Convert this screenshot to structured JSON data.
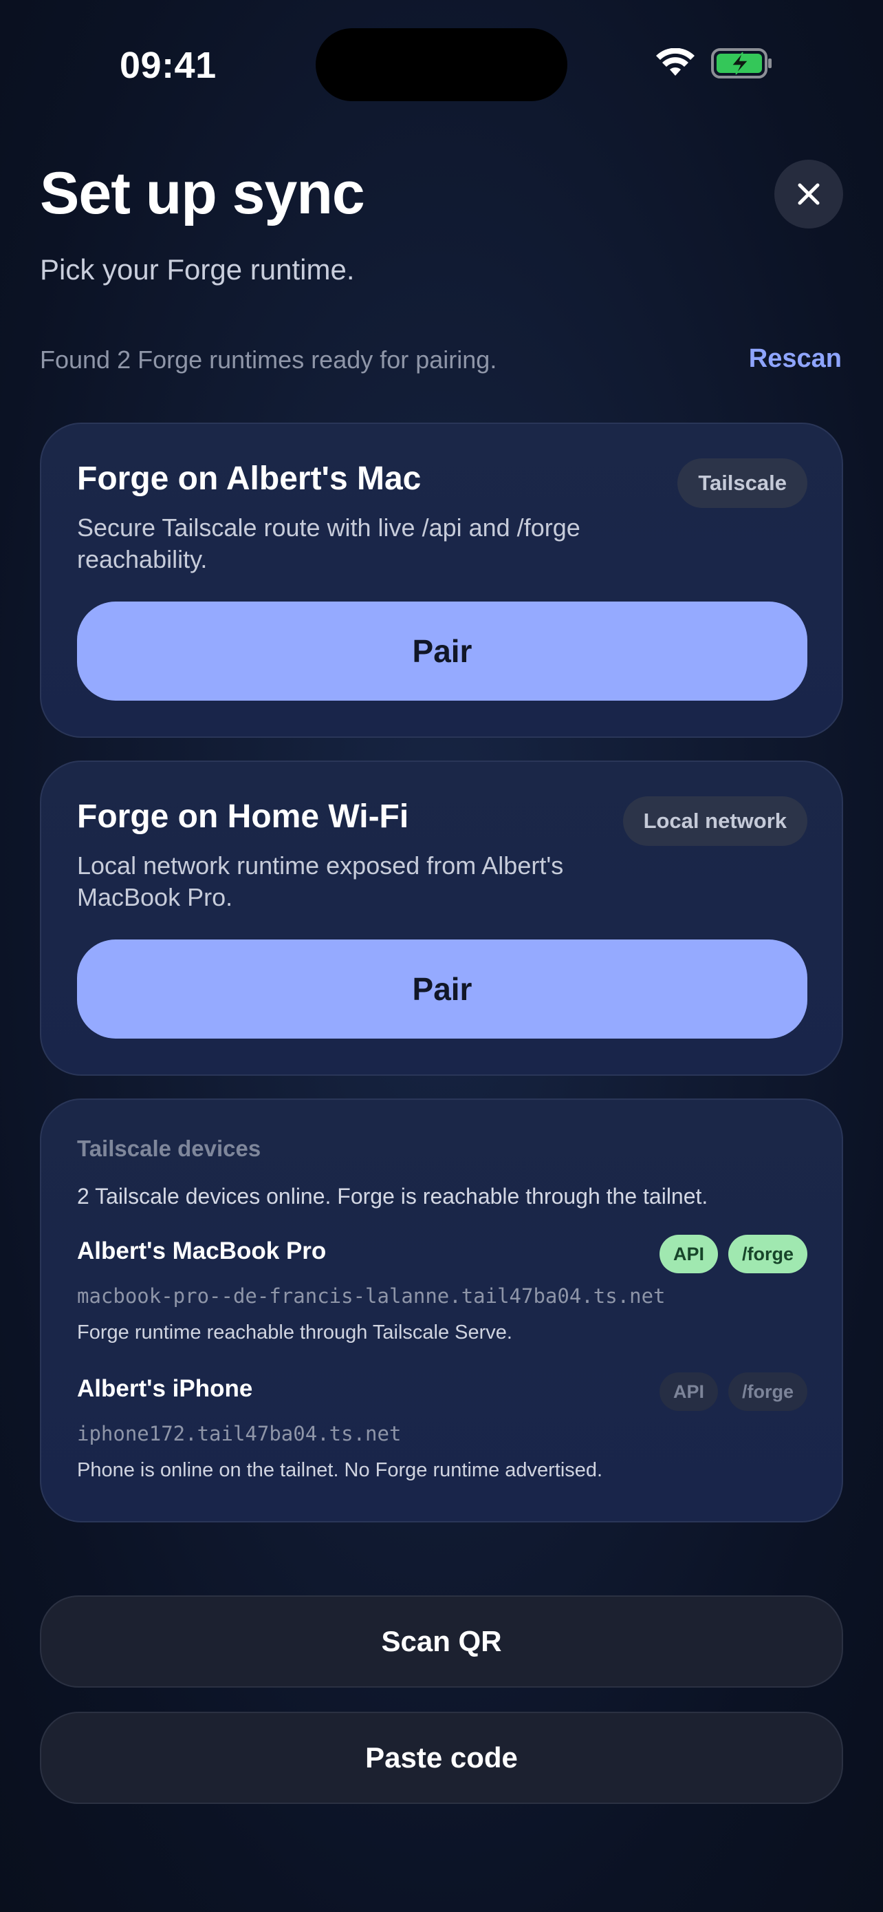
{
  "status_bar": {
    "time": "09:41"
  },
  "header": {
    "title": "Set up sync",
    "subtitle": "Pick your Forge runtime."
  },
  "discovery": {
    "found_text": "Found 2 Forge runtimes ready for pairing.",
    "rescan_label": "Rescan"
  },
  "runtimes": [
    {
      "title": "Forge on Albert's Mac",
      "chip": "Tailscale",
      "description": "Secure Tailscale route with live /api and /forge reachability.",
      "pair_label": "Pair"
    },
    {
      "title": "Forge on Home Wi-Fi",
      "chip": "Local network",
      "description": "Local network runtime exposed from Albert's MacBook Pro.",
      "pair_label": "Pair"
    }
  ],
  "tailscale": {
    "heading": "Tailscale devices",
    "summary": "2 Tailscale devices online. Forge is reachable through the tailnet.",
    "devices": [
      {
        "name": "Albert's MacBook Pro",
        "host": "macbook-pro--de-francis-lalanne.tail47ba04.ts.net",
        "note": "Forge runtime reachable through Tailscale Serve.",
        "tags": [
          "API",
          "/forge"
        ],
        "active": true
      },
      {
        "name": "Albert's iPhone",
        "host": "iphone172.tail47ba04.ts.net",
        "note": "Phone is online on the tailnet. No Forge runtime advertised.",
        "tags": [
          "API",
          "/forge"
        ],
        "active": false
      }
    ]
  },
  "actions": {
    "scan_qr": "Scan QR",
    "paste_code": "Paste code"
  },
  "colors": {
    "accent": "#95aaff",
    "link": "#8fa5ff",
    "tag_active": "#a0e8b0",
    "battery_charging": "#34c759",
    "background": "#111b33"
  },
  "icons": [
    "wifi-icon",
    "battery-charging-icon",
    "close-icon"
  ]
}
